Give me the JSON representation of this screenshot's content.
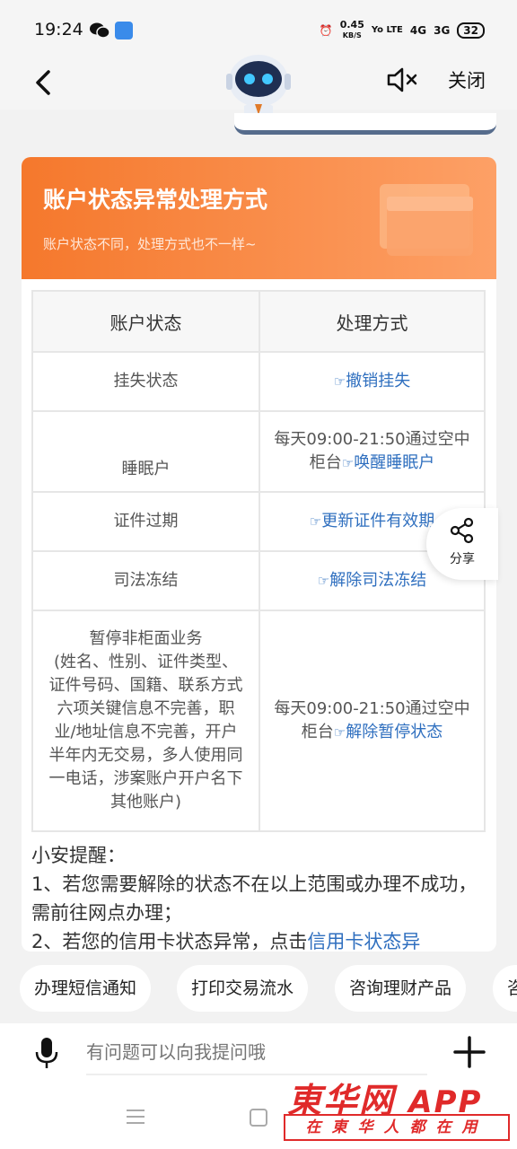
{
  "status_bar": {
    "time": "19:24",
    "net_speed_value": "0.45",
    "net_speed_unit": "KB/S",
    "volte": "Yo LTE",
    "signal1": "4G",
    "signal2": "3G",
    "battery": "32"
  },
  "nav": {
    "back_icon": "chevron-left-icon",
    "mute_icon": "speaker-muted-icon",
    "close_label": "关闭"
  },
  "card": {
    "title": "账户状态异常处理方式",
    "subtitle": "账户状态不同，处理方式也不一样~",
    "accent_color": "#f5782c",
    "table": {
      "headers": [
        "账户状态",
        "处理方式"
      ],
      "rows": [
        {
          "status": "挂失状态",
          "prefix": "",
          "link": "撤销挂失"
        },
        {
          "status": "睡眠户",
          "prefix": "每天09:00-21:50通过空中柜台",
          "link": "唤醒睡眠户"
        },
        {
          "status": "证件过期",
          "prefix": "",
          "link": "更新证件有效期"
        },
        {
          "status": "司法冻结",
          "prefix": "",
          "link": "解除司法冻结"
        },
        {
          "status": "暂停非柜面业务\n(姓名、性别、证件类型、证件号码、国籍、联系方式六项关键信息不完善，职业/地址信息不完善，开户半年内无交易，多人使用同一电话，涉案账户开户名下其他账户)",
          "prefix": "每天09:00-21:50通过空中柜台",
          "link": "解除暂停状态"
        }
      ]
    },
    "reminder": {
      "title": "小安提醒：",
      "item1": "1、若您需要解除的状态不在以上范围或办理不成功，需前往网点办理；",
      "item2_prefix": "2、若您的信用卡状态异常，点击",
      "item2_link": "信用卡状态异"
    }
  },
  "share": {
    "label": "分享",
    "icon": "share-icon"
  },
  "quick_actions": [
    "办理短信通知",
    "打印交易流水",
    "咨询理财产品",
    "咨"
  ],
  "input": {
    "placeholder": "有问题可以向我提问哦",
    "mic_icon": "microphone-icon",
    "plus_icon": "plus-icon"
  },
  "watermark": {
    "main": "東华网",
    "app": "APP",
    "sub": "在東华人都在用"
  }
}
